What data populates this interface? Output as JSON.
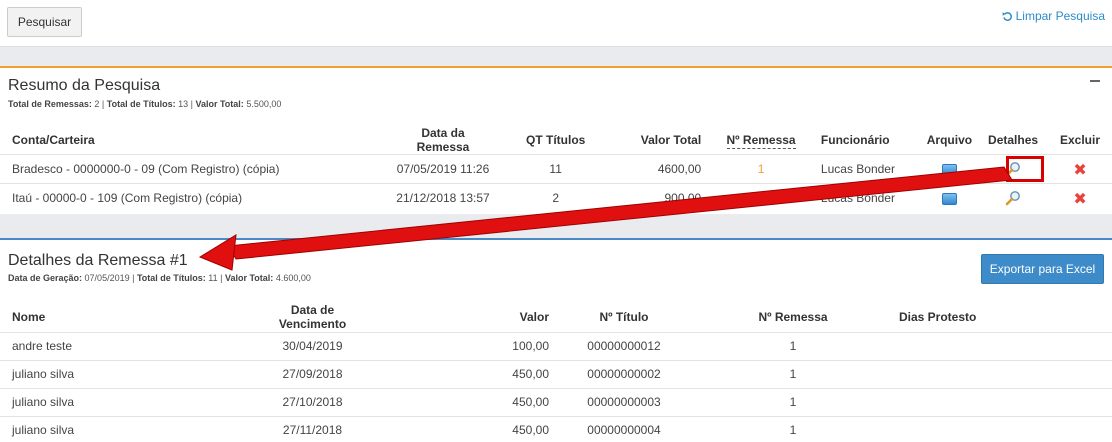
{
  "toolbar": {
    "search_label": "Pesquisar",
    "clear_label": "Limpar Pesquisa"
  },
  "summary": {
    "title": "Resumo da Pesquisa",
    "stats": [
      {
        "label": "Total de Remessas:",
        "value": "2"
      },
      {
        "label": "Total de Títulos:",
        "value": "13"
      },
      {
        "label": "Valor Total:",
        "value": "5.500,00"
      }
    ],
    "columns": [
      "Conta/Carteira",
      "Data da Remessa",
      "QT Títulos",
      "Valor Total",
      "Nº Remessa",
      "Funcionário",
      "Arquivo",
      "Detalhes",
      "Excluir"
    ],
    "rows": [
      {
        "account": "Bradesco - 0000000-0 - 09 (Com Registro) (cópia)",
        "date": "07/05/2019 11:26",
        "qty": "11",
        "total": "4600,00",
        "number": "1",
        "employee": "Lucas Bonder"
      },
      {
        "account": "Itaú - 00000-0 - 109 (Com Registro) (cópia)",
        "date": "21/12/2018 13:57",
        "qty": "2",
        "total": "900,00",
        "number": "1",
        "employee": "Lucas Bonder"
      }
    ]
  },
  "details": {
    "title": "Detalhes da Remessa #1",
    "stats": [
      {
        "label": "Data de Geração:",
        "value": "07/05/2019"
      },
      {
        "label": "Total de Títulos:",
        "value": "11"
      },
      {
        "label": "Valor Total:",
        "value": "4.600,00"
      }
    ],
    "export_label": "Exportar para Excel",
    "columns": [
      "Nome",
      "Data de Vencimento",
      "Valor",
      "Nº Título",
      "Nº Remessa",
      "Dias Protesto"
    ],
    "rows": [
      {
        "name": "andre teste",
        "due": "30/04/2019",
        "value": "100,00",
        "title_no": "00000000012",
        "remessa": "1",
        "protest": ""
      },
      {
        "name": "juliano silva",
        "due": "27/09/2018",
        "value": "450,00",
        "title_no": "00000000002",
        "remessa": "1",
        "protest": ""
      },
      {
        "name": "juliano silva",
        "due": "27/10/2018",
        "value": "450,00",
        "title_no": "00000000003",
        "remessa": "1",
        "protest": ""
      },
      {
        "name": "juliano silva",
        "due": "27/11/2018",
        "value": "450,00",
        "title_no": "00000000004",
        "remessa": "1",
        "protest": ""
      }
    ]
  },
  "colors": {
    "accent_orange": "#f0a030",
    "accent_blue": "#4a8ac4",
    "annotation_red": "#d90000",
    "delete_red": "#e8433a"
  },
  "icons": {
    "clear": "undo-icon",
    "file": "file-icon",
    "details": "magnifier-icon",
    "delete": "close-icon",
    "collapse": "minus-icon"
  }
}
